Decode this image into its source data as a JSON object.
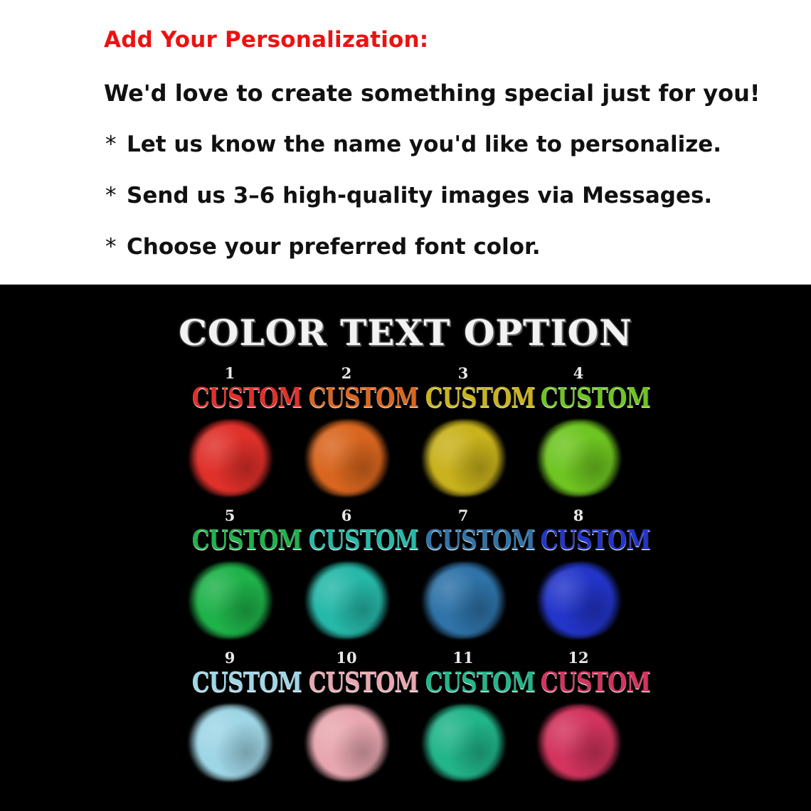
{
  "instructions": {
    "heading": "Add Your Personalization:",
    "intro": "We'd love to create something special just for you!",
    "bullets": [
      "Let us know the name you'd like to personalize.",
      "Send us 3–6 high-quality images via Messages.",
      "Choose your preferred font color."
    ],
    "bullet_marker": "*"
  },
  "color_panel": {
    "title": "COLOR TEXT OPTION",
    "options": [
      {
        "number": "1",
        "text": "CUSTOM",
        "color": "#e0302a"
      },
      {
        "number": "2",
        "text": "CUSTOM",
        "color": "#d9661f"
      },
      {
        "number": "3",
        "text": "CUSTOM",
        "color": "#c9b21c"
      },
      {
        "number": "4",
        "text": "CUSTOM",
        "color": "#6ec521"
      },
      {
        "number": "5",
        "text": "CUSTOM",
        "color": "#1fb24a"
      },
      {
        "number": "6",
        "text": "CUSTOM",
        "color": "#26b8a8"
      },
      {
        "number": "7",
        "text": "CUSTOM",
        "color": "#2f73a8"
      },
      {
        "number": "8",
        "text": "CUSTOM",
        "color": "#2335c9"
      },
      {
        "number": "9",
        "text": "CUSTOM",
        "color": "#9fd6e6"
      },
      {
        "number": "10",
        "text": "CUSTOM",
        "color": "#e8a7b0"
      },
      {
        "number": "11",
        "text": "CUSTOM",
        "color": "#22b58a"
      },
      {
        "number": "12",
        "text": "CUSTOM",
        "color": "#d2345e"
      }
    ]
  }
}
